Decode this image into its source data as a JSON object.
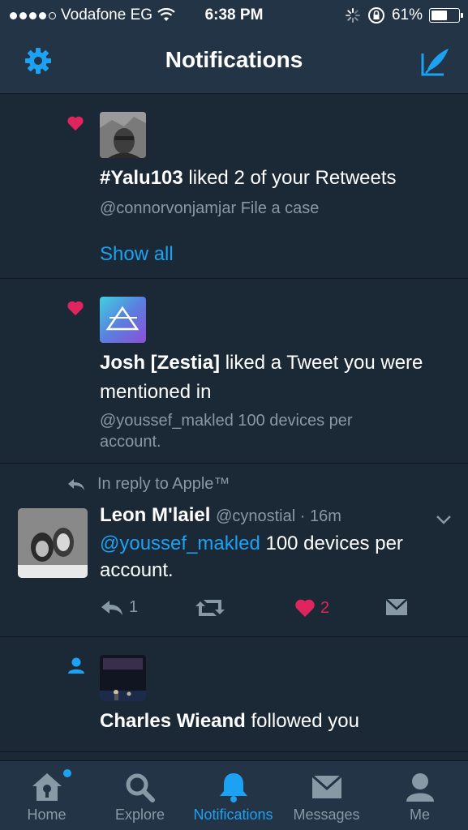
{
  "status": {
    "carrier": "Vodafone EG",
    "time": "6:38 PM",
    "battery": "61%",
    "battery_level": 0.61
  },
  "header": {
    "title": "Notifications",
    "settings_icon": "gear-icon",
    "compose_icon": "compose-tweet-icon"
  },
  "notifications": [
    {
      "type": "like",
      "icon": "heart-icon",
      "actor": "#Yalu103",
      "action": " liked 2 of your Retweets",
      "sub": "@connorvonjamjar File a case",
      "show_all": "Show all"
    },
    {
      "type": "like",
      "icon": "heart-icon",
      "actor": "Josh [Zestia]",
      "action": " liked a Tweet you were mentioned in",
      "sub": "@youssef_makled 100 devices per account."
    },
    {
      "type": "reply",
      "reply_to": "In reply to Apple™",
      "name": "Leon M'laiel",
      "handle": "@cynostial · 16m",
      "mention": "@youssef_makled",
      "text": " 100 devices per account.",
      "reply_count": "1",
      "like_count": "2"
    },
    {
      "type": "follow",
      "icon": "person-icon",
      "actor": "Charles Wieand",
      "action": " followed you"
    }
  ],
  "tabs": [
    {
      "label": "Home",
      "icon": "home-icon"
    },
    {
      "label": "Explore",
      "icon": "search-icon"
    },
    {
      "label": "Notifications",
      "icon": "bell-icon"
    },
    {
      "label": "Messages",
      "icon": "envelope-icon"
    },
    {
      "label": "Me",
      "icon": "person-icon"
    }
  ],
  "colors": {
    "background": "#1b2836",
    "bar": "#243447",
    "accent": "#1da1f2",
    "like": "#e0245e",
    "muted": "#8899a6"
  }
}
